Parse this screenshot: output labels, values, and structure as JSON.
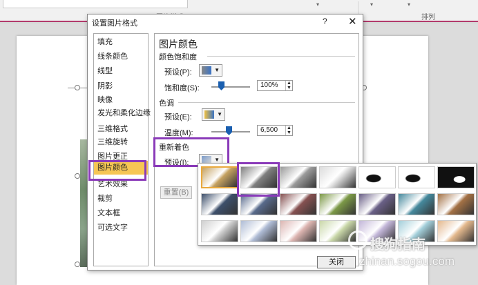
{
  "ribbon": {
    "group_label_1": "图片样式",
    "group_label_2": "排列"
  },
  "dialog": {
    "title": "设置图片格式",
    "help": "?",
    "close": "✕",
    "nav": [
      "填充",
      "线条颜色",
      "线型",
      "阴影",
      "映像",
      "发光和柔化边缘",
      "三维格式",
      "三维旋转",
      "图片更正",
      "图片颜色",
      "艺术效果",
      "裁剪",
      "文本框",
      "可选文字"
    ],
    "panel": {
      "title": "图片颜色",
      "saturation": {
        "section": "颜色饱和度",
        "preset_label": "预设(P):",
        "amount_label": "饱和度(S):",
        "value": "100%",
        "slider_fraction": 0.33
      },
      "tone": {
        "section": "色调",
        "preset_label": "预设(E):",
        "temp_label": "温度(M):",
        "value": "6,500",
        "slider_fraction": 0.5
      },
      "recolor": {
        "section": "重新着色",
        "preset_label": "预设(I):",
        "reset_label": "重置(B)"
      }
    },
    "close_button": "关闭"
  },
  "recolor_swatches": [
    {
      "row": 1,
      "col": 1,
      "color": "#c9a25a",
      "selected": true
    },
    {
      "row": 1,
      "col": 2,
      "color": "#7f7f7f"
    },
    {
      "row": 1,
      "col": 3,
      "color": "#9a9a9a"
    },
    {
      "row": 1,
      "col": 4,
      "color": "#dcdcdc"
    },
    {
      "row": 1,
      "col": 5,
      "color": "#ffffff",
      "bw": true
    },
    {
      "row": 1,
      "col": 6,
      "color": "#ffffff",
      "bw": true
    },
    {
      "row": 1,
      "col": 7,
      "color": "#111111",
      "bw": true
    },
    {
      "row": 2,
      "col": 1,
      "color": "#3b4f6e"
    },
    {
      "row": 2,
      "col": 2,
      "color": "#566a8f"
    },
    {
      "row": 2,
      "col": 3,
      "color": "#8a4f4f"
    },
    {
      "row": 2,
      "col": 4,
      "color": "#7a9a3f"
    },
    {
      "row": 2,
      "col": 5,
      "color": "#6a5f8a"
    },
    {
      "row": 2,
      "col": 6,
      "color": "#3f8aa0"
    },
    {
      "row": 2,
      "col": 7,
      "color": "#a8703f"
    },
    {
      "row": 3,
      "col": 1,
      "color": "#cfcfcf"
    },
    {
      "row": 3,
      "col": 2,
      "color": "#aebcd8"
    },
    {
      "row": 3,
      "col": 3,
      "color": "#e0b4b0"
    },
    {
      "row": 3,
      "col": 4,
      "color": "#c8d8a4"
    },
    {
      "row": 3,
      "col": 5,
      "color": "#c4b6dc"
    },
    {
      "row": 3,
      "col": 6,
      "color": "#9fd0dc"
    },
    {
      "row": 3,
      "col": 7,
      "color": "#e8b888"
    }
  ],
  "watermark": {
    "brand": "搜狗指南",
    "url": "zhinan.sogou.com"
  },
  "accent": "#8a3ab9"
}
